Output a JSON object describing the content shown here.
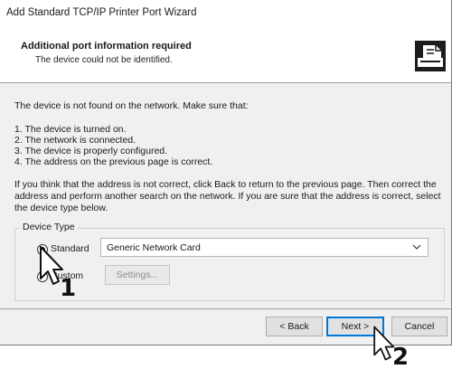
{
  "window": {
    "title": "Add Standard TCP/IP Printer Port Wizard"
  },
  "header": {
    "title": "Additional port information required",
    "subtitle": "The device could not be identified.",
    "icon": "printer-wizard-icon"
  },
  "body": {
    "intro": "The device is not found on the network. Make sure that:",
    "checklist": [
      "1.  The device is turned on.",
      "2.  The network is connected.",
      "3.  The device is properly configured.",
      "4.  The address on the previous page is correct."
    ],
    "advice": "If you think that the address is not correct, click Back to return to the previous page. Then correct the address and perform another search on the network. If you are sure that the address is correct, select the device type below."
  },
  "device_type": {
    "legend": "Device Type",
    "standard_label": "Standard",
    "custom_label": "Custom",
    "selected": "Standard",
    "select_value": "Generic Network Card",
    "settings_label": "Settings..."
  },
  "footer": {
    "back_label": "< Back",
    "next_label": "Next >",
    "cancel_label": "Cancel"
  },
  "callouts": {
    "one": "1",
    "two": "2"
  },
  "colors": {
    "focus_border": "#0078d7",
    "window_bg": "#f0f0f0"
  }
}
